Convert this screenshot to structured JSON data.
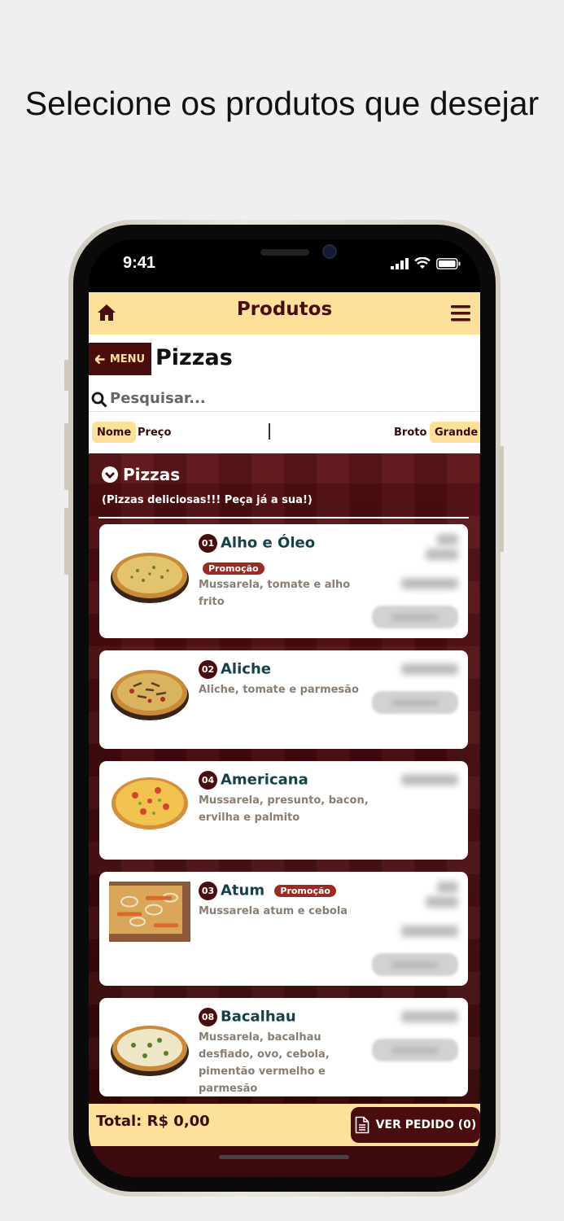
{
  "headline": "Selecione os produtos que desejar",
  "status_bar": {
    "time": "9:41"
  },
  "topbar": {
    "title": "Produtos",
    "home_icon": "home-icon",
    "menu_icon": "hamburger-icon"
  },
  "category": {
    "menu_button": "MENU",
    "title": "Pizzas"
  },
  "search": {
    "placeholder": "Pesquisar..."
  },
  "sort": {
    "name": "Nome",
    "price": "Preço",
    "size_small": "Broto",
    "size_large": "Grande"
  },
  "section": {
    "title": "Pizzas",
    "description": "(Pizzas deliciosas!!! Peça já a sua!)"
  },
  "products": [
    {
      "number": "01",
      "name": "Alho e Óleo",
      "promo": "Promoção",
      "description": "Mussarela, tomate e alho frito"
    },
    {
      "number": "02",
      "name": "Aliche",
      "description": "Aliche, tomate e parmesão"
    },
    {
      "number": "04",
      "name": "Americana",
      "description": "Mussarela, presunto, bacon, ervilha e palmito"
    },
    {
      "number": "03",
      "name": "Atum",
      "promo": "Promoção",
      "description": "Mussarela atum e cebola"
    },
    {
      "number": "08",
      "name": "Bacalhau",
      "description": "Mussarela, bacalhau desfiado, ovo, cebola, pimentão vermelho e parmesão"
    }
  ],
  "footer": {
    "total": "Total: R$ 0,00",
    "order_button": "VER PEDIDO (0)"
  },
  "colors": {
    "accent_yellow": "#fde09a",
    "brand_maroon": "#4a0d0e",
    "name_teal": "#14414a",
    "promo_red": "#9a2a22"
  }
}
